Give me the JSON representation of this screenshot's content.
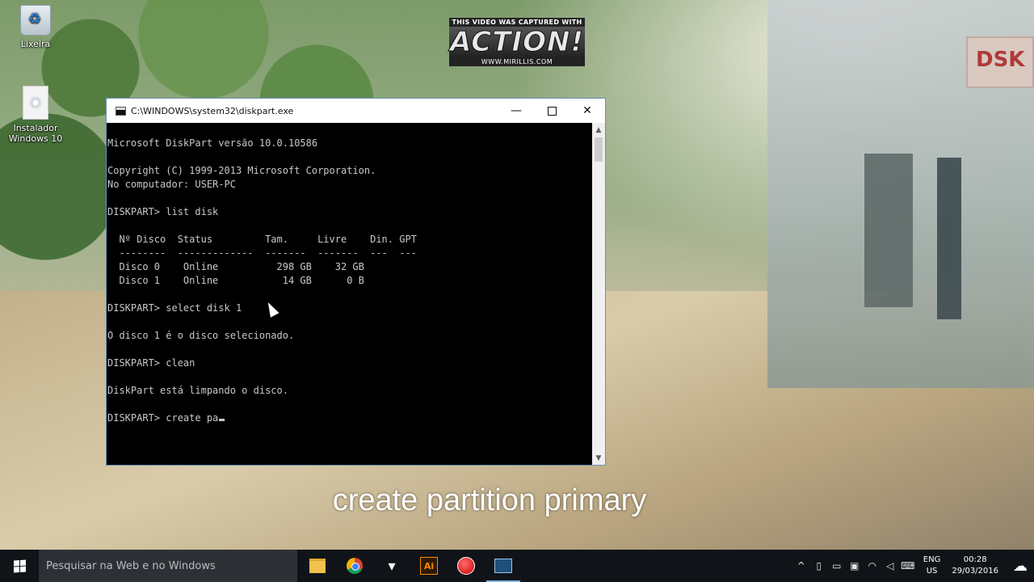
{
  "desktop": {
    "icons": [
      {
        "label": "Lixeira"
      },
      {
        "label": "Instalador\nWindows 10"
      }
    ]
  },
  "watermark": {
    "top": "THIS VIDEO WAS CAPTURED WITH",
    "logo": "ACTION!",
    "url": "WWW.MIRILLIS.COM"
  },
  "wallpaper_sign": "DSK",
  "window": {
    "title": "C:\\WINDOWS\\system32\\diskpart.exe",
    "min_glyph": "—",
    "close_glyph": "✕",
    "console_text": "Microsoft DiskPart versão 10.0.10586\n\nCopyright (C) 1999-2013 Microsoft Corporation.\nNo computador: USER-PC\n\nDISKPART> list disk\n\n  Nº Disco  Status         Tam.     Livre    Din. GPT\n  --------  -------------  -------  -------  ---  ---\n  Disco 0    Online          298 GB    32 GB\n  Disco 1    Online           14 GB      0 B\n\nDISKPART> select disk 1\n\nO disco 1 é o disco selecionado.\n\nDISKPART> clean\n\nDiskPart está limpando o disco.\n\nDISKPART> create pa",
    "scroll_up": "▲",
    "scroll_down": "▼"
  },
  "subtitle": "create partition primary",
  "taskbar": {
    "search_placeholder": "Pesquisar na Web e no Windows",
    "apps": [
      {
        "name": "file-explorer"
      },
      {
        "name": "chrome"
      },
      {
        "name": "foxit"
      },
      {
        "name": "illustrator",
        "label": "Ai"
      },
      {
        "name": "action-recorder"
      },
      {
        "name": "diskpart-console"
      }
    ],
    "tray": {
      "chevron": "^",
      "lang_top": "ENG",
      "lang_bottom": "US",
      "time": "00:28",
      "date": "29/03/2016"
    }
  }
}
